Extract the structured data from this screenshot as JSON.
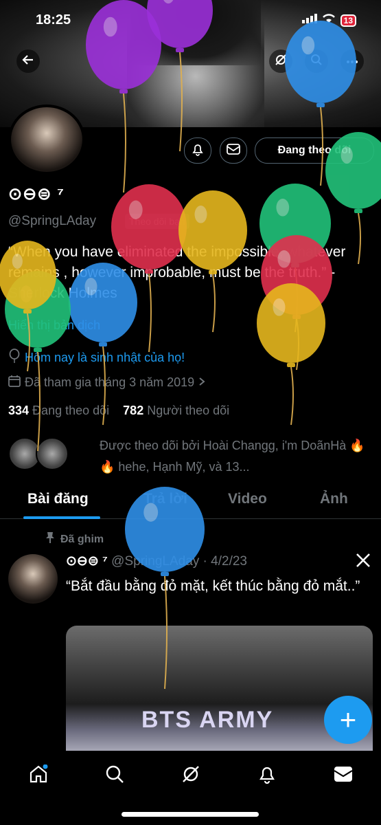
{
  "status_bar": {
    "time": "18:25",
    "battery": "13"
  },
  "profile": {
    "name": "⊙⊖⊜ ⁷",
    "handle": "@SpringLAday",
    "follows_you": "Theo dõi bạn",
    "bio": "“When you have eliminated the impossible, whatever remains , however improbable, must be the truth.” - Sherlock Holmes",
    "translate": "Hiển thị bản dịch",
    "birthday": "Hôm nay là sinh nhật của họ!",
    "joined": "Đã tham gia tháng 3 năm 2019",
    "following_count": "334",
    "following_label": "Đang theo dõi",
    "followers_count": "782",
    "followers_label": "Người theo dõi",
    "followed_by": "Được theo dõi bởi Hoài Changg, i'm DoãnHà 🔥🔥 hehe, Hạnh Mỹ, và 13..."
  },
  "actions": {
    "following_button": "Đang theo dõi"
  },
  "tabs": [
    {
      "label": "Bài đăng"
    },
    {
      "label": "Trả lời"
    },
    {
      "label": "Video"
    },
    {
      "label": "Ảnh"
    }
  ],
  "post": {
    "pinned_label": "Đã ghim",
    "author": "⊙⊖⊜ ⁷",
    "handle": "@SpringLAday",
    "date": "· 4/2/23",
    "text": "“Bắt đầu bằng đỏ mặt, kết thúc bằng đỏ mắt..”",
    "media_text": "BTS ARMY"
  },
  "fab_label": "+",
  "colors": {
    "accent": "#1d9bf0",
    "background": "#000000",
    "muted": "#71767b"
  },
  "balloon_colors": [
    "#9b30d9",
    "#2f8fe8",
    "#e0304e",
    "#e6b71e",
    "#22c27a"
  ]
}
